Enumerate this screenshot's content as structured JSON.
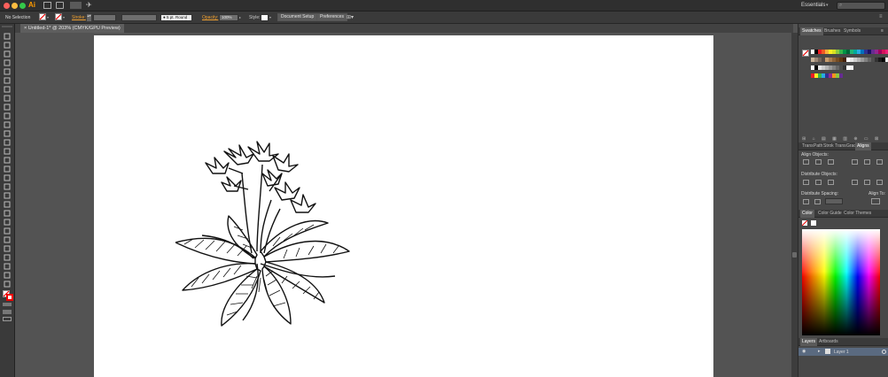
{
  "app": {
    "logo": "Ai",
    "workspace": "Essentials"
  },
  "control": {
    "selection": "No Selection",
    "stroke_label": "Stroke:",
    "brush_value": "5 pt. Round",
    "opacity_label": "Opacity:",
    "opacity_value": "100%",
    "style_label": "Style:",
    "document_setup": "Document Setup",
    "preferences": "Preferences"
  },
  "document": {
    "tab_title": "Untitled-1* @ 203% (CMYK/GPU Preview)"
  },
  "panels": {
    "swatches_tabs": [
      "Swatches",
      "Brushes",
      "Symbols"
    ],
    "mid_tabs": [
      "Trans",
      "Path",
      "Strok",
      "Trans",
      "Grad",
      "Aligns"
    ],
    "align": {
      "align_objects": "Align Objects:",
      "distribute_objects": "Distribute Objects:",
      "distribute_spacing": "Distribute Spacing:",
      "align_to": "Align To:"
    },
    "color_tabs": [
      "Color",
      "Color Guide",
      "Color Themes"
    ],
    "layers_tabs": [
      "Layers",
      "Artboards"
    ],
    "layer_name": "Layer 1"
  },
  "colors": {
    "swatch_row1": [
      "#ffffff",
      "#000000",
      "#ed1c24",
      "#f15a24",
      "#fbb03b",
      "#fcee21",
      "#d9e021",
      "#8cc63f",
      "#39b54a",
      "#009245",
      "#006837",
      "#22b573",
      "#00a99d",
      "#29abe2",
      "#0071bc",
      "#2e3192",
      "#1b1464",
      "#662d91",
      "#93278f",
      "#9e005d",
      "#d4145a",
      "#ed1e79"
    ],
    "swatch_row2": [
      "#c7b299",
      "#998675",
      "#736357",
      "#534741",
      "#c69c6d",
      "#a67c52",
      "#8c6239",
      "#754c24",
      "#603813",
      "#42210b",
      "#ffffff",
      "#e6e6e6",
      "#cccccc",
      "#b3b3b3",
      "#999999",
      "#808080",
      "#666666",
      "#4d4d4d",
      "#333333",
      "#1a1a1a",
      "#000000",
      "#f2f2f2"
    ],
    "swatch_row3": [
      "#ffffff",
      "#000000",
      "#e6e6e6",
      "#cccccc",
      "#b3b3b3",
      "#999999",
      "#808080",
      "#666666",
      "#4d4d4d",
      "#333333",
      "#ffffff",
      "#f2f2f2"
    ],
    "swatch_row4": [
      "#ed1c24",
      "#fcee21",
      "#39b54a",
      "#29abe2",
      "#2e3192",
      "#93278f",
      "#f7931e",
      "#8cc63f",
      "#662d91"
    ]
  }
}
